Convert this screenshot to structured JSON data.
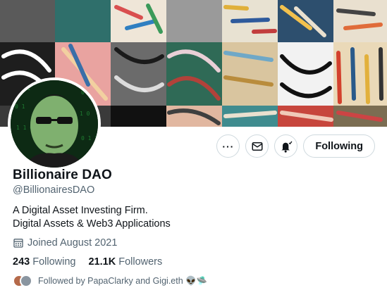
{
  "profile": {
    "display_name": "Billionaire DAO",
    "handle": "@BillionairesDAO",
    "bio_line1": "A Digital Asset Investing Firm.",
    "bio_line2": "Digital Assets & Web3 Applications",
    "joined": "Joined August 2021",
    "following_count": "243",
    "following_label": "Following",
    "followers_count": "21.1K",
    "followers_label": "Followers",
    "followed_by": "Followed by PapaClarky and Gigi.eth 👽🛸"
  },
  "actions": {
    "more_icon": "more-icon",
    "message_icon": "mail-icon",
    "notify_icon": "bell-icon",
    "follow_label": "Following"
  },
  "colors": {
    "text_primary": "#0f1419",
    "text_secondary": "#536471",
    "border": "#cfd9de"
  }
}
